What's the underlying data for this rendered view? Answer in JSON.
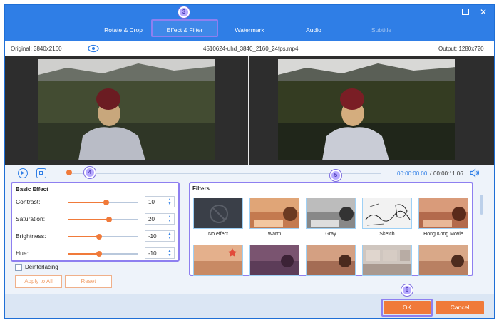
{
  "tabs": [
    {
      "label": "Rotate & Crop"
    },
    {
      "label": "Effect & Filter"
    },
    {
      "label": "Watermark"
    },
    {
      "label": "Audio"
    },
    {
      "label": "Subtitle"
    }
  ],
  "info": {
    "original": "Original: 3840x2160",
    "filename": "4510624-uhd_3840_2160_24fps.mp4",
    "output": "Output: 1280x720"
  },
  "playback": {
    "current_time": "00:00:00.00",
    "separator": "/",
    "total_time": "00:00:11.06"
  },
  "basic_effect": {
    "title": "Basic Effect",
    "rows": [
      {
        "label": "Contrast:",
        "value": "10"
      },
      {
        "label": "Saturation:",
        "value": "20"
      },
      {
        "label": "Brightness:",
        "value": "-10"
      },
      {
        "label": "Hue:",
        "value": "-10"
      }
    ],
    "deinterlacing": "Deinterlacing",
    "apply_all": "Apply to All",
    "reset": "Reset"
  },
  "filters": {
    "title": "Filters",
    "items": [
      {
        "label": "No effect"
      },
      {
        "label": "Warm"
      },
      {
        "label": "Gray"
      },
      {
        "label": "Sketch"
      },
      {
        "label": "Hong Kong Movie"
      },
      {
        "label": ""
      },
      {
        "label": ""
      },
      {
        "label": ""
      },
      {
        "label": ""
      },
      {
        "label": ""
      }
    ]
  },
  "footer": {
    "ok": "OK",
    "cancel": "Cancel"
  },
  "markers": [
    "3",
    "4",
    "5",
    "6"
  ],
  "colors": {
    "accent": "#2f7ee6",
    "highlight": "#8e7ff0",
    "orange": "#f07a3a"
  }
}
